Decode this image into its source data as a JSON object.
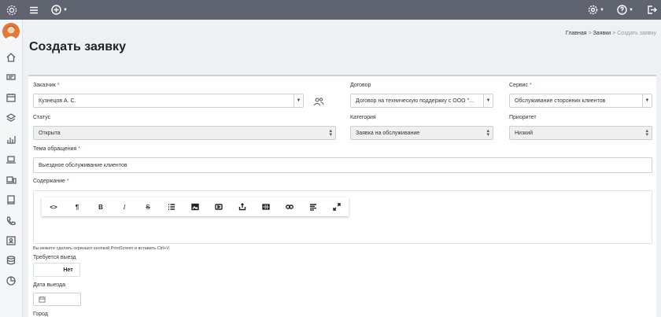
{
  "topbar": {
    "menu_icon": "hamburger-icon",
    "add_icon": "plus-circle-icon",
    "settings_icon": "gear-icon",
    "help_icon": "question-circle-icon",
    "logout_icon": "logout-icon"
  },
  "sidebar": {
    "logo_icon": "gear-logo-icon",
    "items": [
      {
        "icon": "home-icon"
      },
      {
        "icon": "ticket-icon"
      },
      {
        "icon": "calendar-icon"
      },
      {
        "icon": "layers-icon"
      },
      {
        "icon": "chart-icon"
      },
      {
        "icon": "laptop-icon"
      },
      {
        "icon": "devices-icon"
      },
      {
        "icon": "book-icon"
      },
      {
        "icon": "phone-icon"
      },
      {
        "icon": "contact-card-icon"
      },
      {
        "icon": "database-icon"
      },
      {
        "icon": "pie-chart-icon"
      }
    ]
  },
  "page": {
    "title": "Создать заявку",
    "breadcrumb": {
      "home": "Главная",
      "sep1": ">",
      "requests": "Заявки",
      "sep2": ">",
      "current": "Создать заявку"
    }
  },
  "form": {
    "customer": {
      "label": "Заказчик",
      "req": "*",
      "value": "Кузнецов А. С."
    },
    "contract": {
      "label": "Договор",
      "value": "Договор на техническую поддержку с ООО \"..."
    },
    "service": {
      "label": "Сервис",
      "req": "*",
      "value": "Обслуживание сторонних клиентов"
    },
    "status": {
      "label": "Статус",
      "value": "Открыта"
    },
    "category": {
      "label": "Категория",
      "value": "Заявка на обслуживание"
    },
    "priority": {
      "label": "Приоритет",
      "value": "Низкий"
    },
    "subject": {
      "label": "Тема обращения",
      "req": "*",
      "value": "Выездное обслуживание клиентов"
    },
    "content": {
      "label": "Содержание",
      "req": "*"
    },
    "toolbar": {
      "code": "<>",
      "paragraph": "¶",
      "bold": "B",
      "italic": "I",
      "strike": "S"
    },
    "hint": "Вы можете сделать скриншот кнопкой PrintScreen и вставить Ctrl+V.",
    "visit_required": {
      "label": "Требуется выезд",
      "value": "Нет"
    },
    "visit_date": {
      "label": "Дата выезда"
    },
    "city": {
      "label": "Город"
    }
  }
}
